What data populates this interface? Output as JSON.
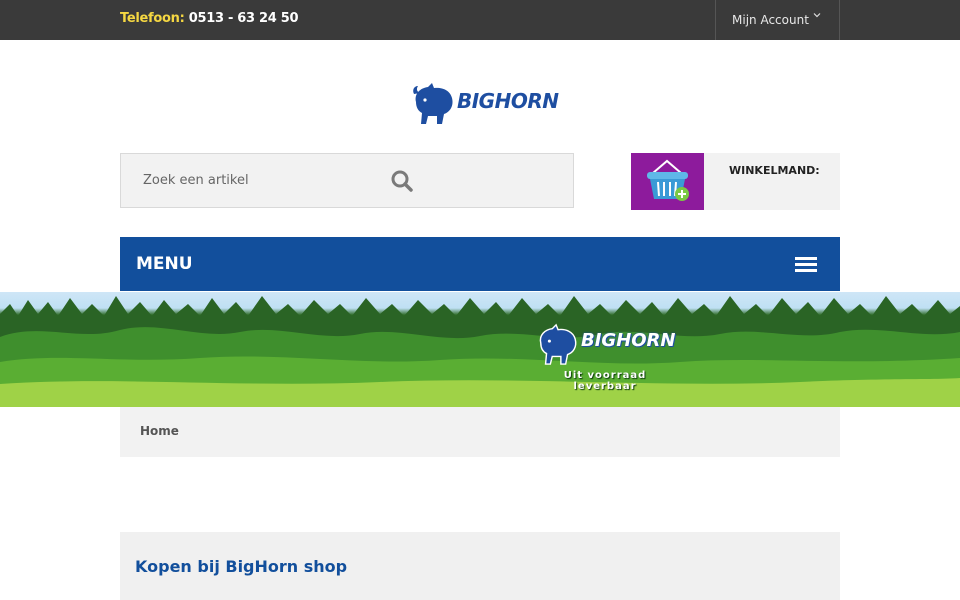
{
  "topbar": {
    "phone_label": "Telefoon:",
    "phone_number": "0513 - 63 24 50",
    "account_label": "Mijn Account"
  },
  "logo": {
    "brand": "BIGHORN"
  },
  "search": {
    "placeholder": "Zoek een artikel"
  },
  "cart": {
    "label": "WINKELMAND:"
  },
  "menu": {
    "label": "MENU"
  },
  "banner": {
    "brand": "BIGHORN",
    "tagline": "Uit voorraad leverbaar"
  },
  "breadcrumb": {
    "home": "Home"
  },
  "section": {
    "title": "Kopen bij BigHorn shop"
  },
  "colors": {
    "topbar": "#3a3a3a",
    "phone_label": "#f5d742",
    "brand_blue": "#124f9c",
    "cart_purple": "#8d1b9c",
    "panel_grey": "#f2f2f2"
  }
}
